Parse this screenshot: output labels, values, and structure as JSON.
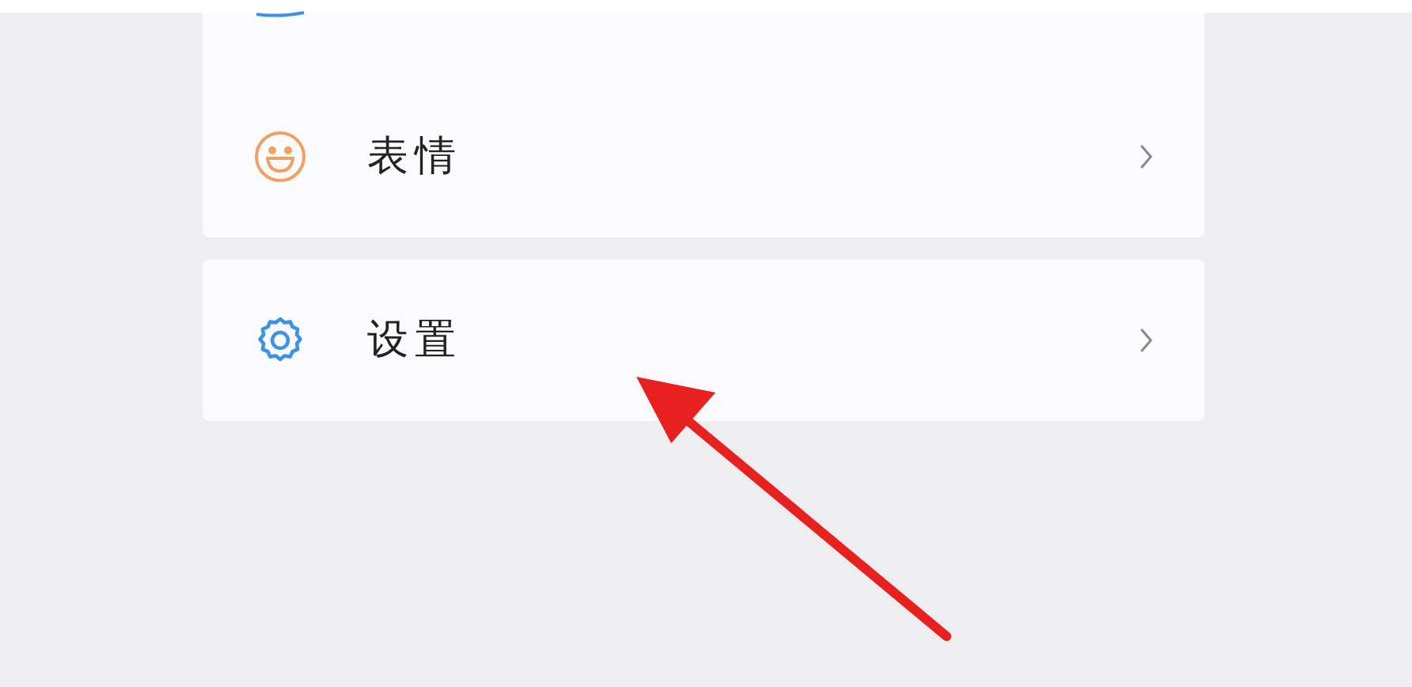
{
  "menu_groups": [
    {
      "items": [
        {
          "kind": "face",
          "label": "表情"
        }
      ]
    },
    {
      "items": [
        {
          "kind": "gear",
          "label": "设置"
        }
      ]
    }
  ]
}
